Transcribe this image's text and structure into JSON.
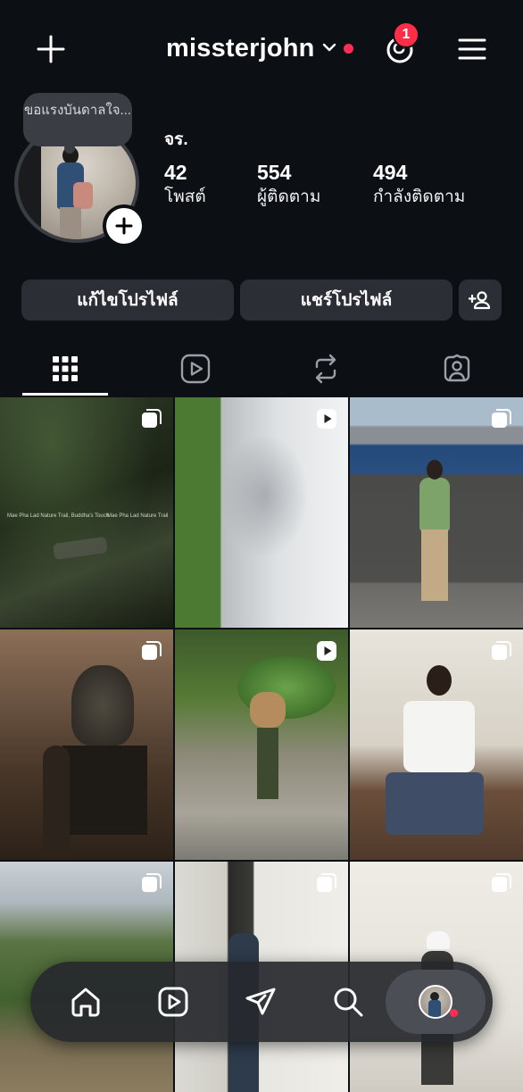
{
  "header": {
    "username": "missterjohn",
    "notification_count": "1"
  },
  "profile": {
    "note": "ขอแรงบันดาลใจ...",
    "display_name": "จร.",
    "stats": [
      {
        "value": "42",
        "label": "โพสต์"
      },
      {
        "value": "554",
        "label": "ผู้ติดตาม"
      },
      {
        "value": "494",
        "label": "กำลังติดตาม"
      }
    ]
  },
  "actions": {
    "edit_profile": "แก้ไขโปรไฟล์",
    "share_profile": "แชร์โปรไฟล์"
  },
  "tabs": [
    "grid-icon",
    "reels-icon",
    "reposts-icon",
    "tagged-icon"
  ],
  "grid_posts": [
    {
      "type": "carousel",
      "overlay_left": "Mae Pha Lad Nature Trail, Buddha's Touch",
      "overlay_right": "Mae Pha Lad Nature Trail"
    },
    {
      "type": "reel"
    },
    {
      "type": "carousel"
    },
    {
      "type": "carousel"
    },
    {
      "type": "reel"
    },
    {
      "type": "carousel"
    },
    {
      "type": "carousel"
    },
    {
      "type": "carousel"
    },
    {
      "type": "carousel"
    }
  ],
  "bottom_nav": [
    "home-icon",
    "reels-icon",
    "send-icon",
    "search-icon",
    "profile-avatar"
  ],
  "colors": {
    "background": "#0c0f14",
    "button": "#2b2e35",
    "badge": "#ff2d45"
  }
}
